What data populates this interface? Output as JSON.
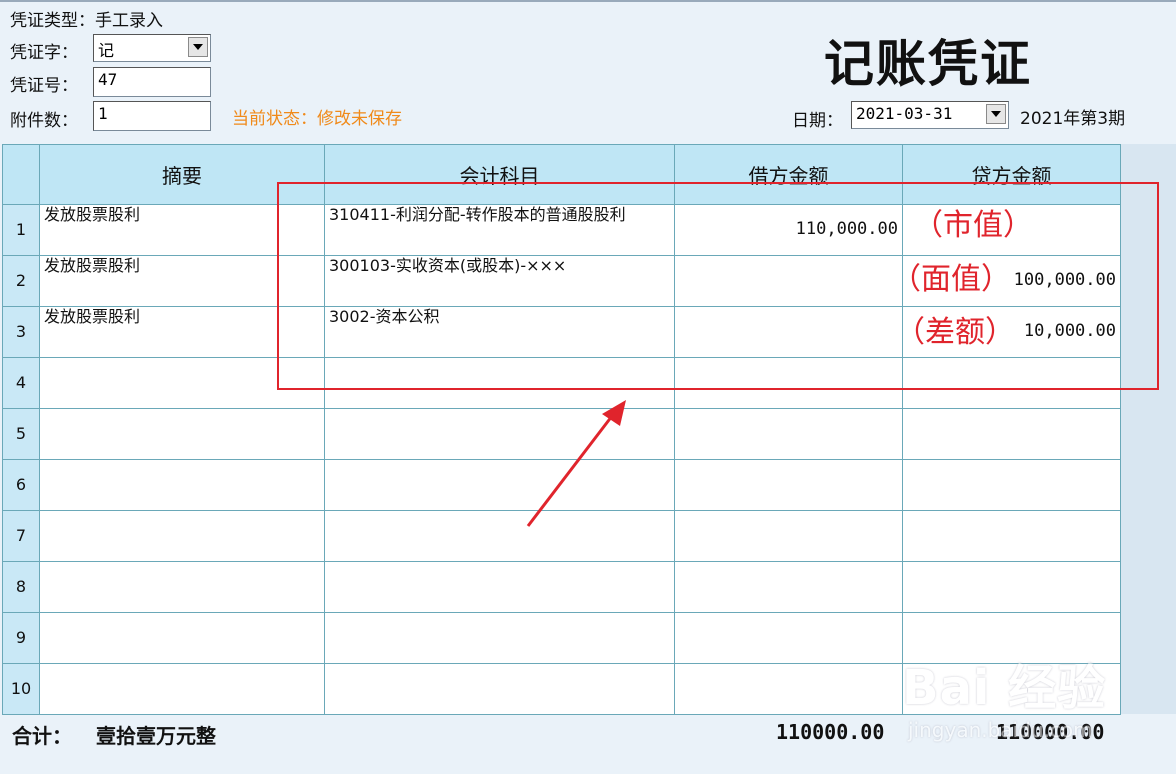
{
  "header": {
    "voucher_type_label": "凭证类型：",
    "voucher_type_value": "手工录入",
    "voucher_word_label": "凭证字：",
    "voucher_word_value": "记",
    "voucher_no_label": "凭证号：",
    "voucher_no_value": "47",
    "attachments_label": "附件数：",
    "attachments_value": "1",
    "status_text": "当前状态：修改未保存",
    "title": "记账凭证",
    "date_label": "日期：",
    "date_value": "2021-03-31",
    "period_text": "2021年第3期"
  },
  "table": {
    "columns": [
      "摘要",
      "会计科目",
      "借方金额",
      "贷方金额"
    ],
    "rows": [
      {
        "no": "1",
        "summary": "发放股票股利",
        "account": "310411-利润分配-转作股本的普通股股利",
        "debit": "110,000.00",
        "credit": ""
      },
      {
        "no": "2",
        "summary": "发放股票股利",
        "account": "300103-实收资本(或股本)-×××",
        "debit": "",
        "credit": "100,000.00"
      },
      {
        "no": "3",
        "summary": "发放股票股利",
        "account": "3002-资本公积",
        "debit": "",
        "credit": "10,000.00"
      },
      {
        "no": "4",
        "summary": "",
        "account": "",
        "debit": "",
        "credit": ""
      },
      {
        "no": "5",
        "summary": "",
        "account": "",
        "debit": "",
        "credit": ""
      },
      {
        "no": "6",
        "summary": "",
        "account": "",
        "debit": "",
        "credit": ""
      },
      {
        "no": "7",
        "summary": "",
        "account": "",
        "debit": "",
        "credit": ""
      },
      {
        "no": "8",
        "summary": "",
        "account": "",
        "debit": "",
        "credit": ""
      },
      {
        "no": "9",
        "summary": "",
        "account": "",
        "debit": "",
        "credit": ""
      },
      {
        "no": "10",
        "summary": "",
        "account": "",
        "debit": "",
        "credit": ""
      }
    ]
  },
  "annotations": {
    "market_value": "（市值）",
    "face_value": "（面值）",
    "difference": "（差额）"
  },
  "totals": {
    "label": "合计：",
    "amount_in_words": "壹拾壹万元整",
    "debit_total": "110000.00",
    "credit_total": "110000.00"
  },
  "watermark": {
    "brand": "Bai  经验",
    "site": "jingyan.baidu.com"
  },
  "colors": {
    "annotation_red": "#e0242c",
    "status_orange": "#f08a1a",
    "header_blue": "#bfe6f5"
  }
}
